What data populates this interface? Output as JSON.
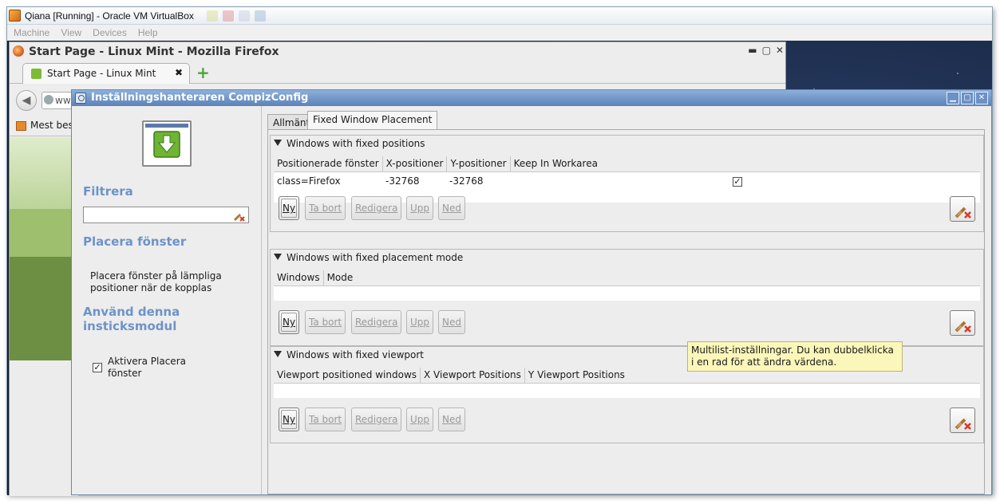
{
  "vbox": {
    "title": "Qiana [Running] - Oracle VM VirtualBox",
    "menu": [
      "Machine",
      "View",
      "Devices",
      "Help"
    ]
  },
  "firefox": {
    "title": "Start Page - Linux Mint - Mozilla Firefox",
    "tab_label": "Start Page - Linux Mint",
    "tab_close": "✖",
    "new_tab": "+",
    "url_partial": "ww",
    "bookmark_label": "Mest bes",
    "window_controls": [
      "▬",
      "▢",
      "✕"
    ]
  },
  "ccsm": {
    "title": "Inställningshanteraren CompizConfig",
    "window_controls": [
      "▁",
      "▢",
      "✕"
    ],
    "sidebar": {
      "filter_heading": "Filtrera",
      "filter_value": "",
      "plugin_heading": "Placera fönster",
      "plugin_description": "Placera fönster på lämpliga positioner när de kopplas",
      "enable_heading": "Använd denna insticksmodul",
      "enable_label": "Aktivera Placera fönster",
      "enable_checked": true
    },
    "tabs": [
      {
        "label": "Allmänt",
        "active": false
      },
      {
        "label": "Fixed Window Placement",
        "active": true
      }
    ],
    "buttons": {
      "new": "Ny",
      "remove": "Ta bort",
      "edit": "Redigera",
      "up": "Upp",
      "down": "Ned"
    },
    "sections": [
      {
        "title": "Windows with fixed positions",
        "columns": [
          "Positionerade fönster",
          "X-positioner",
          "Y-positioner",
          "Keep In Workarea"
        ],
        "rows": [
          {
            "window": "class=Firefox",
            "x": "-32768",
            "y": "-32768",
            "keep_in_workarea": true
          }
        ]
      },
      {
        "title": "Windows with fixed placement mode",
        "columns": [
          "Windows",
          "Mode"
        ],
        "rows": []
      },
      {
        "title": "Windows with fixed viewport",
        "columns": [
          "Viewport positioned windows",
          "X Viewport Positions",
          "Y Viewport Positions"
        ],
        "rows": []
      }
    ],
    "tooltip": "Multilist-inställningar. Du kan dubbelklicka i en rad för att ändra värdena."
  },
  "colors": {
    "ccsm_title_bar": "#5b82b8",
    "sidebar_heading": "#6d93c9",
    "tooltip_bg": "#fbf6b9",
    "desktop_bg": "#1c2d4a"
  }
}
